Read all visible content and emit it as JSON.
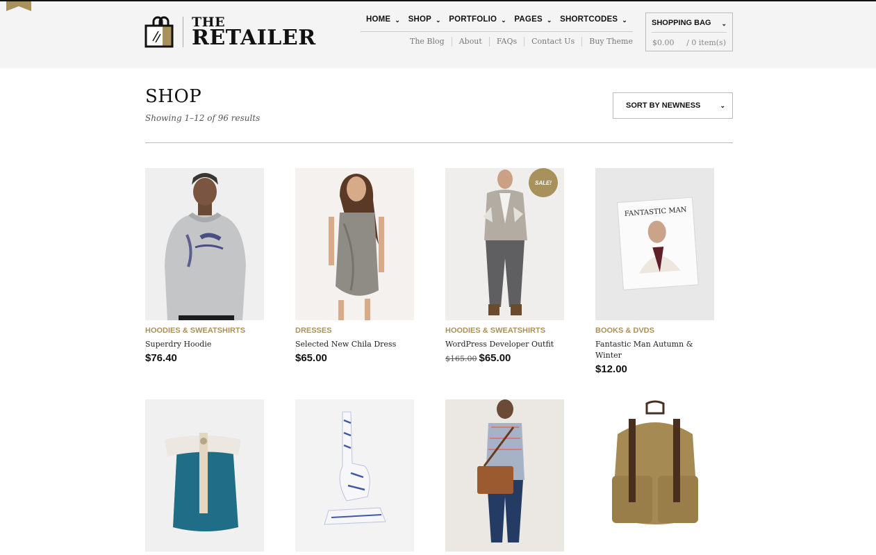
{
  "brand": {
    "line1": "THE",
    "line2": "RETAILER",
    "accent_color": "#a9915c"
  },
  "main_nav": [
    {
      "label": "HOME"
    },
    {
      "label": "SHOP"
    },
    {
      "label": "PORTFOLIO"
    },
    {
      "label": "PAGES"
    },
    {
      "label": "SHORTCODES"
    }
  ],
  "sub_nav": [
    "The Blog",
    "About",
    "FAQs",
    "Contact Us",
    "Buy Theme"
  ],
  "bag": {
    "title": "SHOPPING BAG",
    "total": "$0.00",
    "items": "/ 0 item(s)"
  },
  "shop": {
    "title": "SHOP",
    "result_count": "Showing 1–12 of 96 results",
    "sort_label": "SORT BY NEWNESS"
  },
  "products": [
    {
      "category": "HOODIES & SWEATSHIRTS",
      "name": "Superdry Hoodie",
      "price": "$76.40"
    },
    {
      "category": "DRESSES",
      "name": "Selected New Chila Dress",
      "price": "$65.00"
    },
    {
      "category": "HOODIES & SWEATSHIRTS",
      "name": "WordPress Developer Outfit",
      "old_price": "$165.00",
      "price": "$65.00",
      "badge": "SALE!"
    },
    {
      "category": "BOOKS & DVDS",
      "name": "Fantastic Man Autumn & Winter",
      "price": "$12.00",
      "magazine_title": "FANTASTIC MAN"
    },
    {
      "category": "",
      "name": "",
      "price": ""
    },
    {
      "category": "",
      "name": "",
      "price": ""
    },
    {
      "category": "",
      "name": "",
      "price": ""
    },
    {
      "category": "",
      "name": "",
      "price": ""
    }
  ]
}
